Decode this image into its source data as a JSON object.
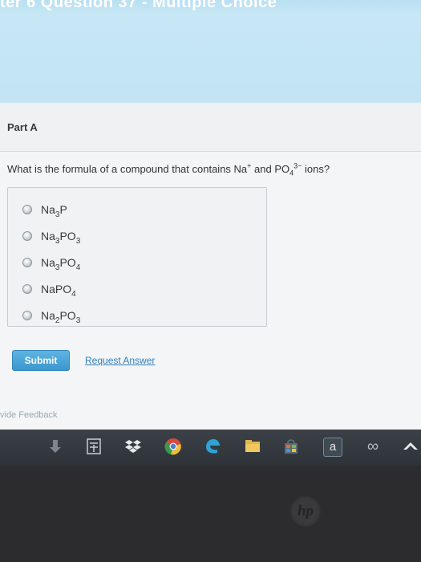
{
  "header": {
    "title": "ter 6 Question 37 - Multiple Choice"
  },
  "part": {
    "label": "Part A"
  },
  "question": {
    "prefix": "What is the formula of a compound that contains Na",
    "na_charge": "+",
    "middle": " and PO",
    "po_sub": "4",
    "po_charge": "3−",
    "suffix": " ions?"
  },
  "options": [
    {
      "parts": [
        "Na",
        "3",
        "P",
        ""
      ]
    },
    {
      "parts": [
        "Na",
        "3",
        "PO",
        "3"
      ]
    },
    {
      "parts": [
        "Na",
        "3",
        "PO",
        "4"
      ]
    },
    {
      "parts": [
        "NaPO",
        "4",
        "",
        ""
      ]
    },
    {
      "parts": [
        "Na",
        "2",
        "PO",
        "3"
      ]
    }
  ],
  "actions": {
    "submit": "Submit",
    "request": "Request Answer"
  },
  "feedback": "vide Feedback",
  "taskbar": {
    "icons": [
      "download-icon",
      "calculator-icon",
      "dropbox-icon",
      "chrome-icon",
      "edge-icon",
      "folder-icon",
      "store-icon",
      "amazon-icon",
      "infinity-icon",
      "arrow-icon"
    ],
    "amazon_letter": "a",
    "infinity_glyph": "∞"
  },
  "bezel": {
    "logo": "hp"
  }
}
